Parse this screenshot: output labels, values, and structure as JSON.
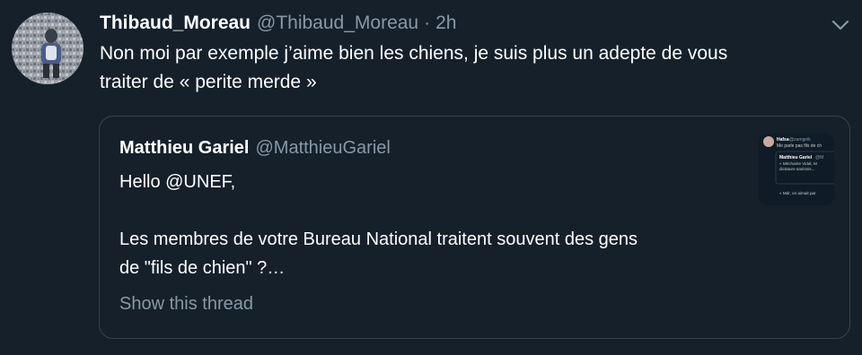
{
  "tweet": {
    "display_name": "Thibaud_Moreau",
    "handle": "@Thibaud_Moreau",
    "separator": "·",
    "time": "2h",
    "text_lines": [
      "Non moi par exemple j’aime bien les chiens, je suis plus un adepte de vous",
      "traiter de « perite merde »"
    ],
    "menu_icon": "chevron-down-icon"
  },
  "quote": {
    "display_name": "Matthieu Gariel",
    "handle": "@MatthieuGariel",
    "lines": [
      "Hello @UNEF,",
      "",
      "Les membres de votre Bureau National traitent souvent des gens",
      "de \"fils de chien\" ?…"
    ],
    "show_thread": "Show this thread",
    "media_thumbnail": {
      "name": "Hafsa",
      "handle": "@zamgeik",
      "line1": "Me parle pas fils de ch",
      "quoted_name": "Matthieu Gariel",
      "quoted_handle": "@M",
      "quoted_line1": "« Méchante Vidal, M",
      "quoted_line2": "dictature sanisnis...",
      "reply": "« Mdr, on aimait par"
    }
  },
  "colors": {
    "background": "#15202b",
    "text_primary": "#ffffff",
    "text_secondary": "#8899a6",
    "border": "#38444d"
  }
}
